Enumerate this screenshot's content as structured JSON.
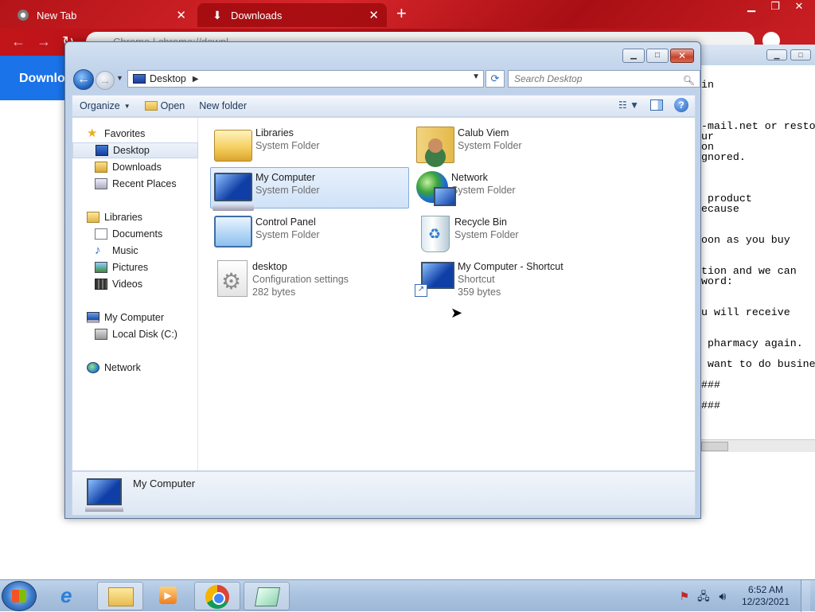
{
  "chrome": {
    "tabs": [
      {
        "label": "New Tab"
      },
      {
        "label": "Downloads"
      }
    ],
    "new_tab_symbol": "+",
    "close_symbol": "✕",
    "omnibox_text": "Chrome | chrome://downl...",
    "downloads_heading": "Downlo"
  },
  "notepad": {
    "lines": "in\n\n\n\n-mail.net or resto\nur\non\ngnored.\n\n\n\n product\necause\n\n\noon as you buy\n\n\ntion and we can\nword:\n\n\nu will receive\n\n\n pharmacy again.\n\n want to do busine\n\n###\n\n###"
  },
  "explorer": {
    "address": {
      "location": "Desktop",
      "separator": "▶"
    },
    "search_placeholder": "Search Desktop",
    "toolbar": {
      "organize": "Organize",
      "open": "Open",
      "new_folder": "New folder"
    },
    "nav": {
      "favorites": "Favorites",
      "desktop": "Desktop",
      "downloads": "Downloads",
      "recent": "Recent Places",
      "libraries": "Libraries",
      "documents": "Documents",
      "music": "Music",
      "pictures": "Pictures",
      "videos": "Videos",
      "my_computer": "My Computer",
      "local_disk": "Local Disk (C:)",
      "network": "Network"
    },
    "items": [
      {
        "name": "Libraries",
        "type": "System Folder"
      },
      {
        "name": "Calub Viem",
        "type": "System Folder"
      },
      {
        "name": "My Computer",
        "type": "System Folder"
      },
      {
        "name": "Network",
        "type": "System Folder"
      },
      {
        "name": "Control Panel",
        "type": "System Folder"
      },
      {
        "name": "Recycle Bin",
        "type": "System Folder"
      },
      {
        "name": "desktop",
        "type": "Configuration settings",
        "size": "282 bytes"
      },
      {
        "name": "My Computer - Shortcut",
        "type": "Shortcut",
        "size": "359 bytes"
      }
    ],
    "details": {
      "name": "My Computer"
    }
  },
  "taskbar": {
    "time": "6:52 AM",
    "date": "12/23/2021"
  }
}
